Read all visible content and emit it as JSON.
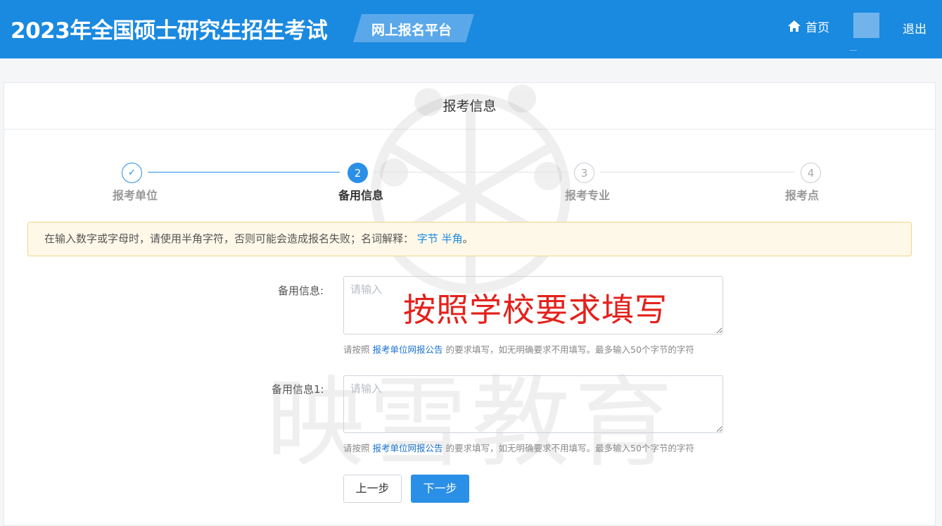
{
  "header": {
    "title": "2023年全国硕士研究生招生考试",
    "platform": "网上报名平台",
    "home_label": "首页",
    "logout_label": "退出",
    "bg_color": "#1a89e0"
  },
  "card": {
    "title": "报考信息"
  },
  "steps": [
    {
      "number": "✓",
      "label": "报考单位",
      "status": "done"
    },
    {
      "number": "2",
      "label": "备用信息",
      "status": "active"
    },
    {
      "number": "3",
      "label": "报考专业",
      "status": "pending"
    },
    {
      "number": "4",
      "label": "报考点",
      "status": "pending"
    }
  ],
  "notice": {
    "text": "在输入数字或字母时，请使用半角字符，否则可能会造成报名失败；名词解释：",
    "link1": "字节",
    "link2": "半角",
    "end": "。"
  },
  "fields": [
    {
      "label": "备用信息:",
      "placeholder": "请输入",
      "hint_prefix": "请按照",
      "hint_link": "报考单位网报公告",
      "hint_suffix": "的要求填写，如无明确要求不用填写。最多输入50个字节的字符"
    },
    {
      "label": "备用信息1:",
      "placeholder": "请输入",
      "hint_prefix": "请按照",
      "hint_link": "报考单位网报公告",
      "hint_suffix": "的要求填写，如无明确要求不用填写。最多输入50个字节的字符"
    }
  ],
  "annotation": "按照学校要求填写",
  "watermark_text": "映雪教育",
  "buttons": {
    "prev": "上一步",
    "next": "下一步"
  }
}
